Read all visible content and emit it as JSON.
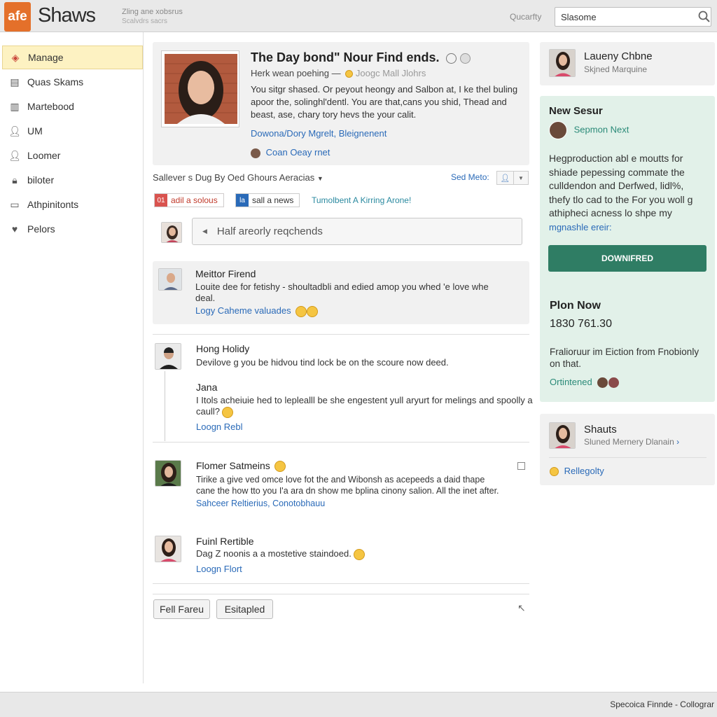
{
  "header": {
    "logo_text": "afe",
    "brand": "Shaws",
    "tagline_line1": "Zling ane xobsrus",
    "tagline_line2": "Scalvdrs sacrs",
    "search_label": "Qucarfty",
    "search_value": "Slasome"
  },
  "sidebar": {
    "items": [
      {
        "label": "Manage"
      },
      {
        "label": "Quas Skams"
      },
      {
        "label": "Martebood"
      },
      {
        "label": "UM"
      },
      {
        "label": "Loomer"
      },
      {
        "label": "biloter"
      },
      {
        "label": "Athpinitonts"
      },
      {
        "label": "Pelors"
      }
    ]
  },
  "featured": {
    "title": "The Day bond\" Nour Find ends.",
    "subtitle": "Herk wean poehing —",
    "subtitle_link": "Joogc Mall Jlohrs",
    "body_line1": "You sitgr shased. Or peyout heongy and Salbon at, I ke thel buling",
    "body_line2": "apoor the, solinghl'dentl. You are that,cans you shid, Thead and",
    "body_line3": "beast, ase, chary tory hevs the your calit.",
    "link": "Dowona/Dory Mgrelt, Bleignenent",
    "author": "Coan Oeay rnet"
  },
  "feed_bar": {
    "sort_label": "Sallever s Dug By Oed Ghours Aeracias",
    "view_label": "Sed Meto:",
    "tag1": "adil a solous",
    "tag2": "sall a news",
    "tag3": "Tumolbent A Kirring Arone!",
    "compose_placeholder": "Half areorly reqchends"
  },
  "posts": [
    {
      "name": "Meittor Firend",
      "body1": "Louite dee for fetishy - shoultadbli and edied amop you whed 'e love whe",
      "body2": "deal.",
      "link": "Logy Caheme valuades"
    },
    {
      "name": "Hong Holidy",
      "body1": "Devilove g you be hidvou tind lock be on the scoure now deed.",
      "body2": "",
      "link": ""
    },
    {
      "name": "Jana",
      "body1": "I Itols acheiuie hed to leplealll be she engestent yull aryurt for melings and spoolly a",
      "body2": "caull?",
      "link": "Loogn Rebl"
    },
    {
      "name": "Flomer Satmeins",
      "body1": "Tirike a give ved omce love fot the and Wibonsh as acepeeds a daid thape",
      "body2": "cane the how tto you I'a ara dn show me bplina cinony salion. All the inet after.",
      "link": "Sahceer Reltierius, Conotobhauu"
    },
    {
      "name": "Fuinl Rertible",
      "body1": "Dag Z noonis a a mostetive staindoed.",
      "body2": "",
      "link": "Loogn Flort"
    }
  ],
  "bottom_buttons": {
    "left": "Fell Fareu",
    "right": "Esitapled"
  },
  "right_panel": {
    "profile_name": "Laueny Chbne",
    "profile_sub": "Skjned Marquine",
    "promo_title": "New Sesur",
    "promo_user": "Sepmon Next",
    "promo_body1": "Hegproduction abl e moutts for",
    "promo_body2": "shiade pepessing commate the",
    "promo_body3": "culldendon and Derfwed, lidl%,",
    "promo_body4": "thefy tlo cad to the For you woll g",
    "promo_body5": "athipheci acness lo shpe my",
    "promo_link": "mgnashle ereir:",
    "promo_button": "DOWNIFRED",
    "plan_title": "Plon Now",
    "plan_number": "1830 761.30",
    "plan_desc1": "Fralioruur im Eiction from Fnobionly",
    "plan_desc2": "on that.",
    "plan_link": "Ortintened",
    "card3_name": "Shauts",
    "card3_sub": "Sluned Mernery Dlanain",
    "card3_link": "Rellegolty"
  },
  "footer": {
    "text": "Specoica Finnde - Collograr"
  },
  "colors": {
    "accent_orange": "#e4702a",
    "link_blue": "#2a6ab8",
    "promo_green": "#2f7d64",
    "promo_bg": "#e2f1e9"
  }
}
